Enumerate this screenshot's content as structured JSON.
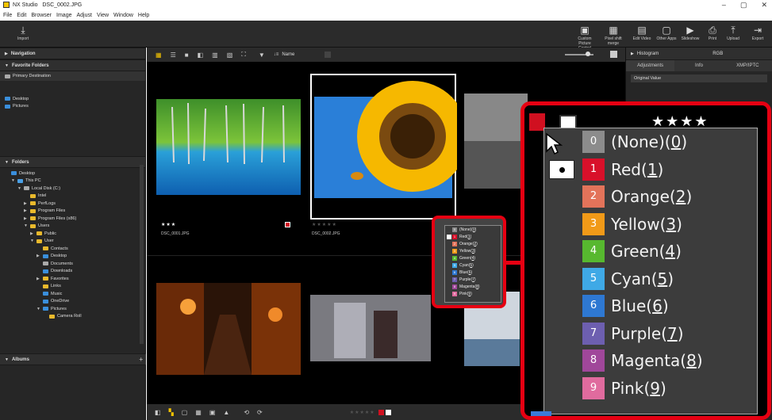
{
  "window": {
    "app": "NX Studio",
    "file": "DSC_0002.JPG",
    "controls": [
      "–",
      "▢",
      "✕"
    ]
  },
  "menu": [
    "File",
    "Edit",
    "Browser",
    "Image",
    "Adjust",
    "View",
    "Window",
    "Help"
  ],
  "toolbar": {
    "import": "Import",
    "right_tools": [
      "Custom Picture Control",
      "Pixel shift merge",
      "Edit Video",
      "Other Apps",
      "Slideshow",
      "Print",
      "Upload",
      "Export"
    ]
  },
  "left": {
    "navigation": "Navigation",
    "favorite_folders": "Favorite Folders",
    "primary_destination": "Primary Destination",
    "favorites": [
      "Desktop",
      "Pictures"
    ],
    "folders": "Folders",
    "tree": [
      {
        "label": "Desktop",
        "indent": 0,
        "icon": "blue"
      },
      {
        "label": "This PC",
        "indent": 1,
        "icon": "pc",
        "tri": "▼"
      },
      {
        "label": "Local Disk (C:)",
        "indent": 2,
        "icon": "gray",
        "tri": "▼"
      },
      {
        "label": "Intel",
        "indent": 3,
        "icon": "folder"
      },
      {
        "label": "PerfLogs",
        "indent": 3,
        "icon": "folder",
        "tri": "▶"
      },
      {
        "label": "Program Files",
        "indent": 3,
        "icon": "folder",
        "tri": "▶"
      },
      {
        "label": "Program Files (x86)",
        "indent": 3,
        "icon": "folder",
        "tri": "▶"
      },
      {
        "label": "Users",
        "indent": 3,
        "icon": "folder",
        "tri": "▼"
      },
      {
        "label": "Public",
        "indent": 4,
        "icon": "folder",
        "tri": "▶"
      },
      {
        "label": "User",
        "indent": 4,
        "icon": "folder",
        "tri": "▼"
      },
      {
        "label": "Contacts",
        "indent": 5,
        "icon": "folder"
      },
      {
        "label": "Desktop",
        "indent": 5,
        "icon": "blue",
        "tri": "▶"
      },
      {
        "label": "Documents",
        "indent": 5,
        "icon": "gray"
      },
      {
        "label": "Downloads",
        "indent": 5,
        "icon": "blue"
      },
      {
        "label": "Favorites",
        "indent": 5,
        "icon": "folder",
        "tri": "▶"
      },
      {
        "label": "Links",
        "indent": 5,
        "icon": "folder"
      },
      {
        "label": "Music",
        "indent": 5,
        "icon": "blue"
      },
      {
        "label": "OneDrive",
        "indent": 5,
        "icon": "blue"
      },
      {
        "label": "Pictures",
        "indent": 5,
        "icon": "blue",
        "tri": "▼"
      },
      {
        "label": "Camera Roll",
        "indent": 6,
        "icon": "folder"
      }
    ],
    "albums": "Albums"
  },
  "grid": {
    "sort_label": "Name",
    "thumbs": [
      {
        "caption": "DSC_0001.JPG",
        "stars": "★★★"
      },
      {
        "caption": "DSC_0002.JPG",
        "stars": "★★★★★"
      }
    ],
    "bottom_stars": "★★★★★"
  },
  "right": {
    "histogram": "Histogram",
    "channel": "RGB",
    "tabs": [
      "Adjustments",
      "Info",
      "XMP/IPTC"
    ],
    "preset": "Original Value"
  },
  "labels": [
    {
      "num": "0",
      "name": "(None)",
      "key": "0",
      "color": "#8c8c8c"
    },
    {
      "num": "1",
      "name": "Red",
      "key": "1",
      "color": "#d8102a"
    },
    {
      "num": "2",
      "name": "Orange",
      "key": "2",
      "color": "#e3735a"
    },
    {
      "num": "3",
      "name": "Yellow",
      "key": "3",
      "color": "#f19a18"
    },
    {
      "num": "4",
      "name": "Green",
      "key": "4",
      "color": "#57b82f"
    },
    {
      "num": "5",
      "name": "Cyan",
      "key": "5",
      "color": "#3fa9e6"
    },
    {
      "num": "6",
      "name": "Blue",
      "key": "6",
      "color": "#2e78d2"
    },
    {
      "num": "7",
      "name": "Purple",
      "key": "7",
      "color": "#6d5fb0"
    },
    {
      "num": "8",
      "name": "Magenta",
      "key": "8",
      "color": "#a0479a"
    },
    {
      "num": "9",
      "name": "Pink",
      "key": "9",
      "color": "#e06b9e"
    }
  ],
  "selected_label": "1"
}
